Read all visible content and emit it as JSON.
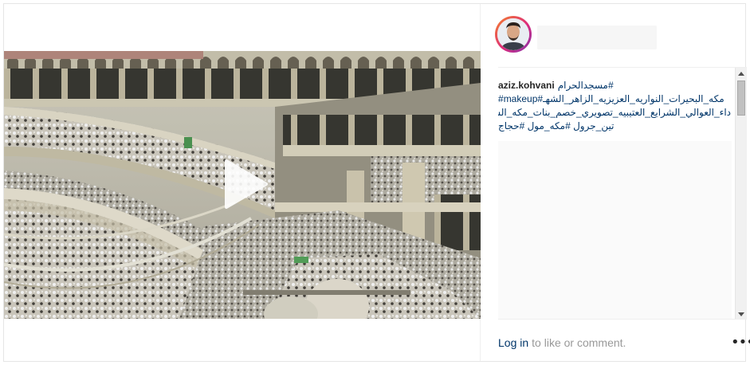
{
  "post": {
    "username": "aziz.kohvani",
    "caption_line1": "#مسجدالحرام",
    "caption_line2": "مكه_البحيرات_النواريه_العزيزيه_الزاهر_الشهـ#makeup#",
    "caption_line3": "داء_العوالي_الشرايع_العتيبيه_تصويري_خصم_بنات_مكه_السـ",
    "caption_line4": "تين_جرول #مكه_مول #حجاج"
  },
  "media": {
    "type": "video",
    "play_icon": "play-icon"
  },
  "footer": {
    "login_label": "Log in",
    "login_suffix": "to like or comment.",
    "more_icon": "more-options-icon",
    "more_glyph": "•••"
  },
  "colors": {
    "link": "#003569",
    "muted": "#999999",
    "text": "#262626",
    "avatar_ring_start": "#f58529",
    "avatar_ring_end": "#8134af"
  }
}
